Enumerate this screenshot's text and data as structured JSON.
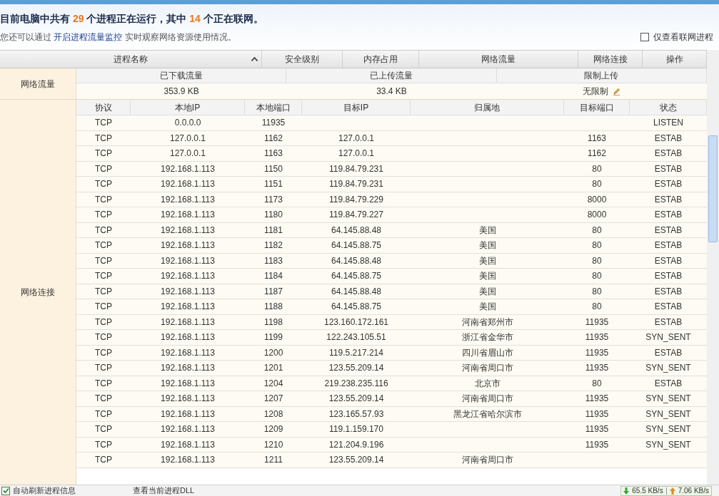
{
  "summary": {
    "prefix": "目前电脑中共有",
    "total": "29",
    "middle": "个进程正在运行，其中",
    "online": "14",
    "suffix": "个正在联网。"
  },
  "hint": {
    "before": "您还可以通过",
    "link": "开启进程流量监控",
    "after": "实时观察网络资源使用情况。"
  },
  "online_only": {
    "label": "仅查看联网进程",
    "checked": false
  },
  "columns": [
    "进程名称",
    "安全级别",
    "内存占用",
    "网络流量",
    "网络连接",
    "操作"
  ],
  "traffic": {
    "label": "网络流量",
    "headers": [
      "已下载流量",
      "已上传流量",
      "限制上传"
    ],
    "values": [
      "353.9 KB",
      "33.4 KB",
      "无限制"
    ]
  },
  "connections": {
    "label": "网络连接",
    "headers": [
      "协议",
      "本地IP",
      "本地端口",
      "目标IP",
      "归属地",
      "目标端口",
      "状态"
    ],
    "rows": [
      {
        "protocol": "TCP",
        "local_ip": "0.0.0.0",
        "local_port": "11935",
        "state": "LISTEN"
      },
      {
        "protocol": "TCP",
        "local_ip": "127.0.0.1",
        "local_port": "1162",
        "remote_ip": "127.0.0.1",
        "remote_port": "1163",
        "state": "ESTAB"
      },
      {
        "protocol": "TCP",
        "local_ip": "127.0.0.1",
        "local_port": "1163",
        "remote_ip": "127.0.0.1",
        "remote_port": "1162",
        "state": "ESTAB"
      },
      {
        "protocol": "TCP",
        "local_ip": "192.168.1.113",
        "local_port": "1150",
        "remote_ip": "119.84.79.231",
        "remote_port": "80",
        "state": "ESTAB"
      },
      {
        "protocol": "TCP",
        "local_ip": "192.168.1.113",
        "local_port": "1151",
        "remote_ip": "119.84.79.231",
        "remote_port": "80",
        "state": "ESTAB"
      },
      {
        "protocol": "TCP",
        "local_ip": "192.168.1.113",
        "local_port": "1173",
        "remote_ip": "119.84.79.229",
        "remote_port": "8000",
        "state": "ESTAB"
      },
      {
        "protocol": "TCP",
        "local_ip": "192.168.1.113",
        "local_port": "1180",
        "remote_ip": "119.84.79.227",
        "remote_port": "8000",
        "state": "ESTAB"
      },
      {
        "protocol": "TCP",
        "local_ip": "192.168.1.113",
        "local_port": "1181",
        "remote_ip": "64.145.88.48",
        "location": "美国",
        "remote_port": "80",
        "state": "ESTAB"
      },
      {
        "protocol": "TCP",
        "local_ip": "192.168.1.113",
        "local_port": "1182",
        "remote_ip": "64.145.88.75",
        "location": "美国",
        "remote_port": "80",
        "state": "ESTAB"
      },
      {
        "protocol": "TCP",
        "local_ip": "192.168.1.113",
        "local_port": "1183",
        "remote_ip": "64.145.88.48",
        "location": "美国",
        "remote_port": "80",
        "state": "ESTAB"
      },
      {
        "protocol": "TCP",
        "local_ip": "192.168.1.113",
        "local_port": "1184",
        "remote_ip": "64.145.88.75",
        "location": "美国",
        "remote_port": "80",
        "state": "ESTAB"
      },
      {
        "protocol": "TCP",
        "local_ip": "192.168.1.113",
        "local_port": "1187",
        "remote_ip": "64.145.88.48",
        "location": "美国",
        "remote_port": "80",
        "state": "ESTAB"
      },
      {
        "protocol": "TCP",
        "local_ip": "192.168.1.113",
        "local_port": "1188",
        "remote_ip": "64.145.88.75",
        "location": "美国",
        "remote_port": "80",
        "state": "ESTAB"
      },
      {
        "protocol": "TCP",
        "local_ip": "192.168.1.113",
        "local_port": "1198",
        "remote_ip": "123.160.172.161",
        "location": "河南省郑州市",
        "remote_port": "11935",
        "state": "ESTAB"
      },
      {
        "protocol": "TCP",
        "local_ip": "192.168.1.113",
        "local_port": "1199",
        "remote_ip": "122.243.105.51",
        "location": "浙江省金华市",
        "remote_port": "11935",
        "state": "SYN_SENT"
      },
      {
        "protocol": "TCP",
        "local_ip": "192.168.1.113",
        "local_port": "1200",
        "remote_ip": "119.5.217.214",
        "location": "四川省眉山市",
        "remote_port": "11935",
        "state": "ESTAB"
      },
      {
        "protocol": "TCP",
        "local_ip": "192.168.1.113",
        "local_port": "1201",
        "remote_ip": "123.55.209.14",
        "location": "河南省周口市",
        "remote_port": "11935",
        "state": "SYN_SENT"
      },
      {
        "protocol": "TCP",
        "local_ip": "192.168.1.113",
        "local_port": "1204",
        "remote_ip": "219.238.235.116",
        "location": "北京市",
        "remote_port": "80",
        "state": "ESTAB"
      },
      {
        "protocol": "TCP",
        "local_ip": "192.168.1.113",
        "local_port": "1207",
        "remote_ip": "123.55.209.14",
        "location": "河南省周口市",
        "remote_port": "11935",
        "state": "SYN_SENT"
      },
      {
        "protocol": "TCP",
        "local_ip": "192.168.1.113",
        "local_port": "1208",
        "remote_ip": "123.165.57.93",
        "location": "黑龙江省哈尔滨市",
        "remote_port": "11935",
        "state": "SYN_SENT"
      },
      {
        "protocol": "TCP",
        "local_ip": "192.168.1.113",
        "local_port": "1209",
        "remote_ip": "119.1.159.170",
        "remote_port": "11935",
        "state": "SYN_SENT"
      },
      {
        "protocol": "TCP",
        "local_ip": "192.168.1.113",
        "local_port": "1210",
        "remote_ip": "121.204.9.196",
        "remote_port": "11935",
        "state": "SYN_SENT"
      },
      {
        "protocol": "TCP",
        "local_ip": "192.168.1.113",
        "local_port": "1211",
        "remote_ip": "123.55.209.14",
        "location": "河南省周口市"
      }
    ]
  },
  "footer": {
    "auto_refresh": {
      "label": "自动刷新进程信息",
      "checked": true
    },
    "dll_link": "查看当前进程DLL"
  },
  "speed": {
    "down": "65.5 KB/s",
    "up": "7.06 KB/s"
  }
}
